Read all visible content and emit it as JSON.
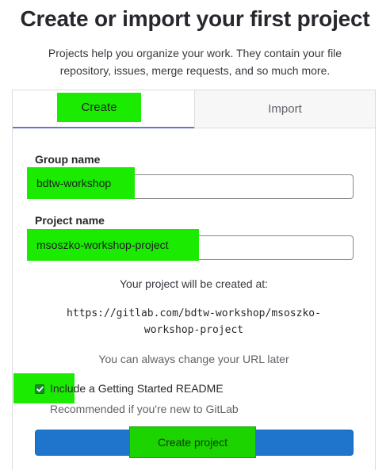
{
  "header": {
    "title": "Create or import your first project",
    "subtitle": "Projects help you organize your work. They contain your file repository, issues, merge requests, and so much more."
  },
  "tabs": [
    {
      "label": "Create",
      "active": true
    },
    {
      "label": "Import",
      "active": false
    }
  ],
  "form": {
    "group_name": {
      "label": "Group name",
      "value": "bdtw-workshop"
    },
    "project_name": {
      "label": "Project name",
      "value": "msoszko-workshop-project"
    },
    "url_intro": "Your project will be created at:",
    "url_line1": "https://gitlab.com/bdtw-workshop/msoszko-",
    "url_line2": "workshop-project",
    "url_note": "You can always change your URL later",
    "readme": {
      "checked": true,
      "label": "Include a Getting Started README",
      "help": "Recommended if you're new to GitLab"
    },
    "submit_label": "Create project"
  },
  "colors": {
    "highlight": "#1aeb00",
    "primary_button": "#1f75cb",
    "active_tab_border": "#6b72c9",
    "checkbox": "#178c2e"
  }
}
